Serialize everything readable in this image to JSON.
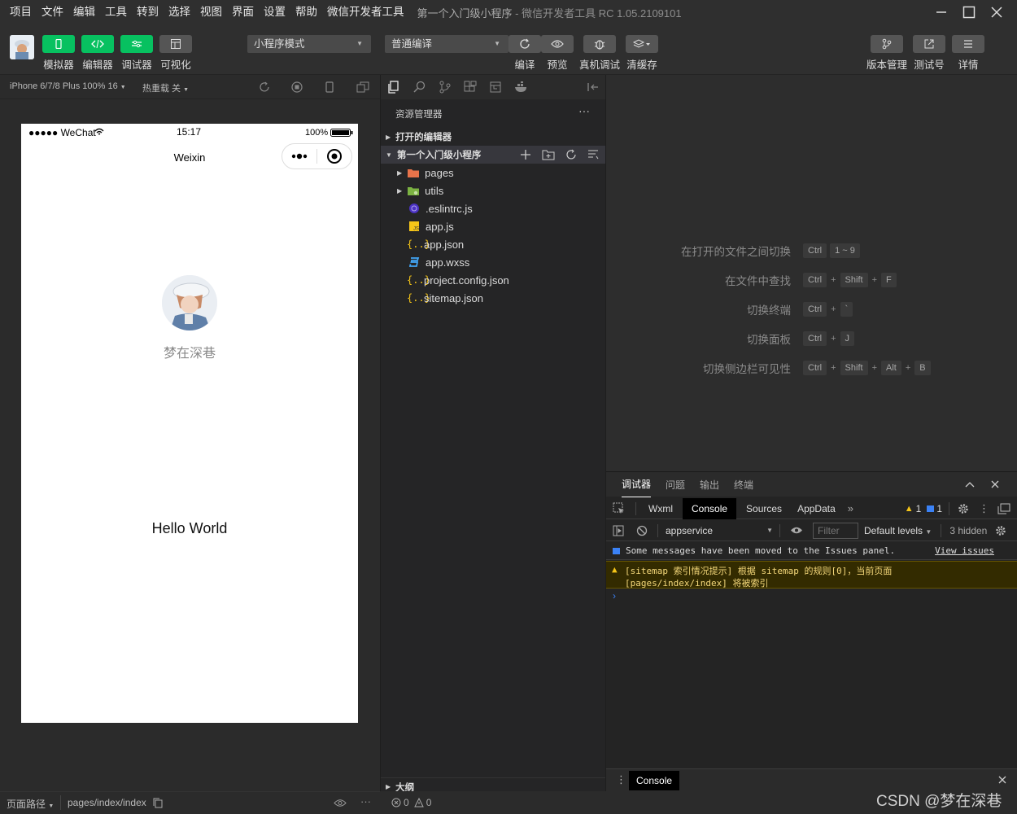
{
  "menubar": {
    "items": [
      "项目",
      "文件",
      "编辑",
      "工具",
      "转到",
      "选择",
      "视图",
      "界面",
      "设置",
      "帮助",
      "微信开发者工具"
    ],
    "window_title_project": "第一个入门级小程序",
    "window_title_app": "- 微信开发者工具 RC 1.05.2109101"
  },
  "toolbar": {
    "simulator": "模拟器",
    "editor": "编辑器",
    "debugger": "调试器",
    "visual": "可视化",
    "mode_select": "小程序模式",
    "compile_select": "普通编译",
    "compile": "编译",
    "preview": "预览",
    "remote_debug": "真机调试",
    "clear_cache": "清缓存",
    "version_mgmt": "版本管理",
    "test_account": "测试号",
    "details": "详情"
  },
  "simulator": {
    "device": "iPhone 6/7/8 Plus 100% 16",
    "hot_reload": "热重载 关",
    "status_carrier": "●●●●● WeChat",
    "status_time": "15:17",
    "status_battery": "100%",
    "nav_title": "Weixin",
    "nickname": "梦在深巷",
    "hello": "Hello World",
    "footer_path_label": "页面路径",
    "footer_path": "pages/index/index"
  },
  "explorer": {
    "title": "资源管理器",
    "open_editors": "打开的编辑器",
    "project": "第一个入门级小程序",
    "files": [
      {
        "name": "pages",
        "icon": "folder-pages-icon"
      },
      {
        "name": "utils",
        "icon": "folder-utils-icon"
      },
      {
        "name": ".eslintrc.js",
        "icon": "eslint-icon"
      },
      {
        "name": "app.js",
        "icon": "js-icon"
      },
      {
        "name": "app.json",
        "icon": "json-icon"
      },
      {
        "name": "app.wxss",
        "icon": "css-icon"
      },
      {
        "name": "project.config.json",
        "icon": "json-icon"
      },
      {
        "name": "sitemap.json",
        "icon": "json-icon"
      }
    ],
    "outline": "大纲"
  },
  "shortcuts": [
    {
      "label": "在打开的文件之间切换",
      "keys": [
        "Ctrl",
        "1 ~ 9"
      ]
    },
    {
      "label": "在文件中查找",
      "keys": [
        "Ctrl",
        "Shift",
        "F"
      ]
    },
    {
      "label": "切换终端",
      "keys": [
        "Ctrl",
        "`"
      ]
    },
    {
      "label": "切换面板",
      "keys": [
        "Ctrl",
        "J"
      ]
    },
    {
      "label": "切换侧边栏可见性",
      "keys": [
        "Ctrl",
        "Shift",
        "Alt",
        "B"
      ]
    }
  ],
  "devtools": {
    "panel_tabs": [
      "调试器",
      "问题",
      "输出",
      "终端"
    ],
    "tabs": [
      "Wxml",
      "Console",
      "Sources",
      "AppData"
    ],
    "warn_count": "1",
    "info_count": "1",
    "context": "appservice",
    "filter_placeholder": "Filter",
    "levels": "Default levels",
    "hidden": "3 hidden",
    "issues_msg": "Some messages have been moved to the Issues panel.",
    "view_issues": "View issues",
    "warn_line1": "[sitemap 索引情况提示] 根据 sitemap 的规则[0]，当前页面",
    "warn_line2": "[pages/index/index] 将被索引",
    "drawer_tab": "Console"
  },
  "statusbar": {
    "errors": "0",
    "warnings": "0",
    "watermark": "CSDN @梦在深巷"
  },
  "colors": {
    "accent": "#07c160",
    "warn_bg": "#332b00",
    "warn_text": "#f5d87a"
  }
}
